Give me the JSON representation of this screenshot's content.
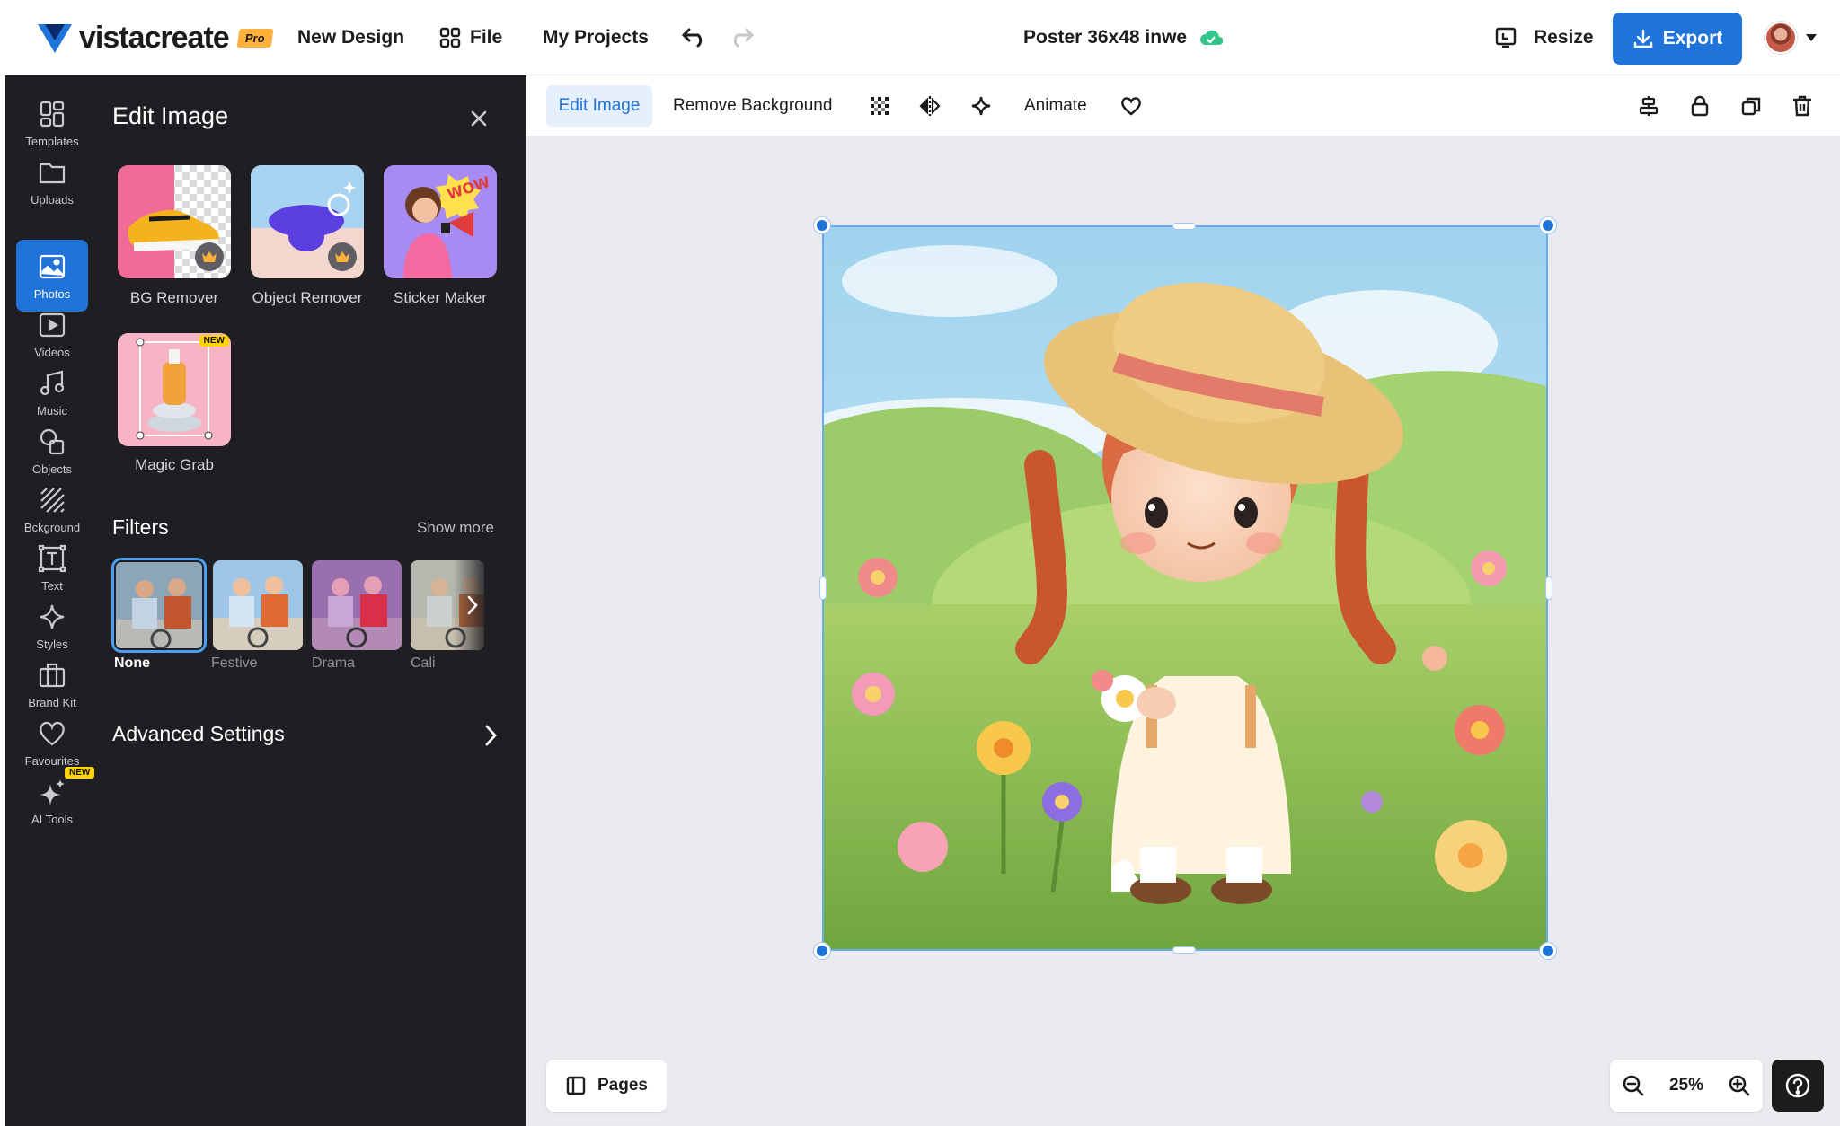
{
  "header": {
    "logo_text": "vistacreate",
    "logo_badge": "Pro",
    "nav": [
      "New Design",
      "File",
      "My Projects"
    ],
    "doc_title": "Poster 36x48 inwe",
    "resize_label": "Resize",
    "export_label": "Export",
    "brand_color": "#1f73d9"
  },
  "sidebar": {
    "items": [
      {
        "label": "Templates",
        "icon": "templates-icon"
      },
      {
        "label": "Uploads",
        "icon": "folder-icon"
      },
      {
        "label": "Photos",
        "icon": "photo-icon",
        "active": true
      },
      {
        "label": "Videos",
        "icon": "video-icon"
      },
      {
        "label": "Music",
        "icon": "music-icon"
      },
      {
        "label": "Objects",
        "icon": "shapes-icon"
      },
      {
        "label": "Bckground",
        "icon": "background-icon"
      },
      {
        "label": "Text",
        "icon": "text-icon"
      },
      {
        "label": "Styles",
        "icon": "sparkle-icon"
      },
      {
        "label": "Brand Kit",
        "icon": "briefcase-icon"
      },
      {
        "label": "Favourites",
        "icon": "heart-icon"
      },
      {
        "label": "AI Tools",
        "icon": "ai-sparkle-icon",
        "badge": "NEW"
      }
    ]
  },
  "panel": {
    "title": "Edit Image",
    "tools": [
      {
        "label": "BG Remover"
      },
      {
        "label": "Object Remover"
      },
      {
        "label": "Sticker Maker"
      },
      {
        "label": "Magic Grab",
        "badge": "NEW"
      }
    ],
    "sticker_text": "WOW",
    "filters_title": "Filters",
    "show_more": "Show more",
    "filters": [
      {
        "label": "None",
        "selected": true
      },
      {
        "label": "Festive"
      },
      {
        "label": "Drama"
      },
      {
        "label": "Cali"
      }
    ],
    "advanced_settings": "Advanced Settings"
  },
  "toolbar": {
    "edit_image": "Edit Image",
    "remove_background": "Remove Background",
    "animate": "Animate"
  },
  "canvas": {
    "pages_label": "Pages",
    "zoom_level": "25%"
  }
}
